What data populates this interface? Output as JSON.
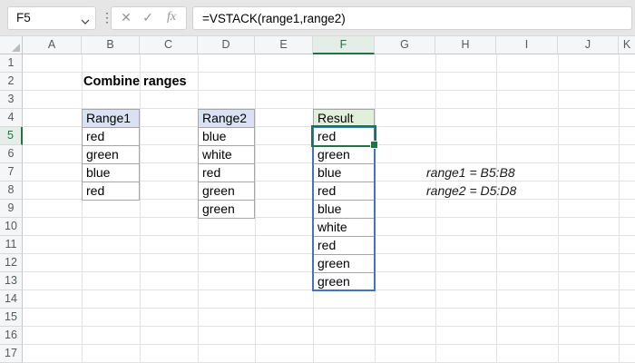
{
  "formula_bar": {
    "name_box_value": "F5",
    "formula": "=VSTACK(range1,range2)",
    "cancel_icon": "✕",
    "enter_icon": "✓",
    "fx_label": "fx",
    "dots": "⋮"
  },
  "grid": {
    "columns": [
      "A",
      "B",
      "C",
      "D",
      "E",
      "F",
      "G",
      "H",
      "I",
      "J",
      "K"
    ],
    "rows": [
      "1",
      "2",
      "3",
      "4",
      "5",
      "6",
      "7",
      "8",
      "9",
      "10",
      "11",
      "12",
      "13",
      "14",
      "15",
      "16",
      "17"
    ],
    "selected_cell": "F5",
    "selected_column": "F",
    "selected_row": "5"
  },
  "content": {
    "title": "Combine ranges",
    "range1": {
      "header": "Range1",
      "values": [
        "red",
        "green",
        "blue",
        "red"
      ]
    },
    "range2": {
      "header": "Range2",
      "values": [
        "blue",
        "white",
        "red",
        "green",
        "green"
      ]
    },
    "result": {
      "header": "Result",
      "values": [
        "red",
        "green",
        "blue",
        "red",
        "blue",
        "white",
        "red",
        "green",
        "green"
      ]
    },
    "annotations": [
      "range1 = B5:B8",
      "range2 = D5:D8"
    ]
  },
  "colors": {
    "accent_green": "#217346",
    "spill_blue": "#4472c4",
    "range_header_fill": "#d9e1f2",
    "result_header_fill": "#e2efda",
    "gridline": "#e0e2e3"
  }
}
